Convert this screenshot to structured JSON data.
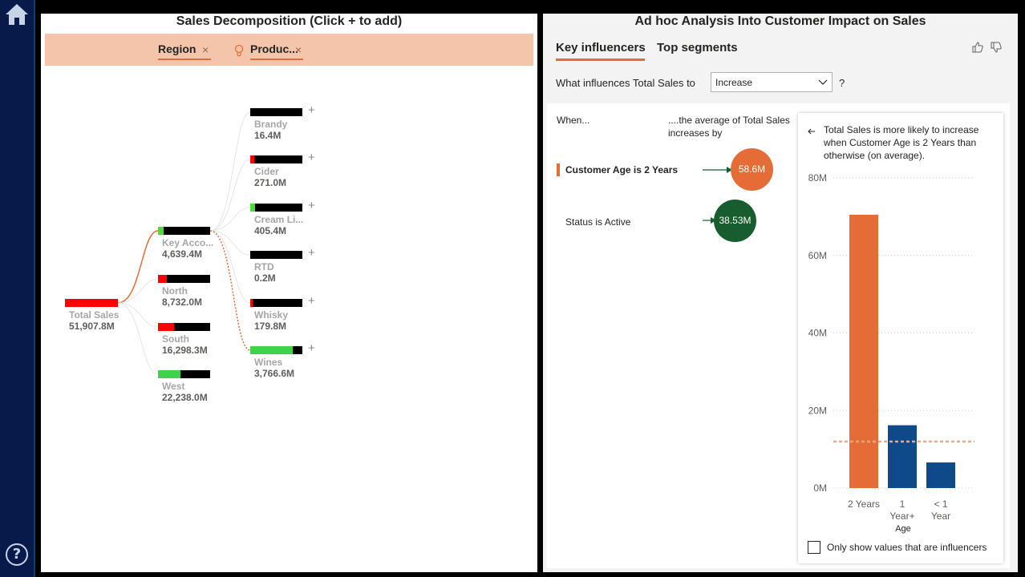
{
  "nav": {
    "help_glyph": "?"
  },
  "decomposition": {
    "title": "Sales Decomposition (Click + to add)",
    "levels": [
      {
        "label": "Region",
        "close": "×"
      },
      {
        "label": "Produc...",
        "close": "×",
        "icon": "lightbulb-icon"
      }
    ],
    "root": {
      "label": "Total Sales",
      "value": "51,907.8M"
    },
    "regions": [
      {
        "label": "Key Acco...",
        "value": "4,639.4M",
        "fill": 0.1,
        "fill_color": "#4ade3a"
      },
      {
        "label": "North",
        "value": "8,732.0M",
        "fill": 0.17,
        "fill_color": "#ff0000"
      },
      {
        "label": "South",
        "value": "16,298.3M",
        "fill": 0.31,
        "fill_color": "#ff0000"
      },
      {
        "label": "West",
        "value": "22,238.0M",
        "fill": 0.43,
        "fill_color": "#3ed34b"
      }
    ],
    "products": [
      {
        "label": "Brandy",
        "value": "16.4M",
        "fill": 0.0,
        "fill_color": "#000000"
      },
      {
        "label": "Cider",
        "value": "271.0M",
        "fill": 0.07,
        "fill_color": "#ff0000"
      },
      {
        "label": "Cream Li...",
        "value": "405.4M",
        "fill": 0.09,
        "fill_color": "#4ade3a"
      },
      {
        "label": "RTD",
        "value": "0.2M",
        "fill": 0.0,
        "fill_color": "#000000"
      },
      {
        "label": "Whisky",
        "value": "179.8M",
        "fill": 0.04,
        "fill_color": "#ff0000"
      },
      {
        "label": "Wines",
        "value": "3,766.6M",
        "fill": 0.81,
        "fill_color": "#3ed34b"
      }
    ],
    "plus": "+"
  },
  "analysis": {
    "title": "Ad hoc Analysis Into Customer Impact on Sales",
    "tabs": [
      "Key influencers",
      "Top segments"
    ],
    "question_prefix": "What influences Total Sales to",
    "dropdown_value": "Increase",
    "question_suffix": "?",
    "col_when": "When...",
    "col_avg": "....the average of Total Sales increases by",
    "influencers": [
      {
        "label": "Customer Age is 2 Years",
        "value": "58.6M",
        "color": "#e66c37"
      },
      {
        "label": "Status is Active",
        "value": "38.53M",
        "color": "#175d2d"
      }
    ],
    "detail_text": "Total Sales is more likely to increase when Customer Age is 2 Years than otherwise (on average).",
    "checkbox_label": "Only show values that are influencers"
  },
  "chart_data": {
    "type": "bar",
    "categories": [
      "2 Years",
      "1 Year+",
      "< 1 Year"
    ],
    "values": [
      70.5,
      16.2,
      6.6
    ],
    "colors": [
      "#e66c37",
      "#0e4a8a",
      "#0e4a8a"
    ],
    "xlabel": "Age",
    "y_ticks": [
      "0M",
      "20M",
      "40M",
      "60M",
      "80M"
    ],
    "ylim": [
      0,
      80
    ],
    "reference_line": 12,
    "reference_color": "#f2a77e",
    "grid": true
  }
}
